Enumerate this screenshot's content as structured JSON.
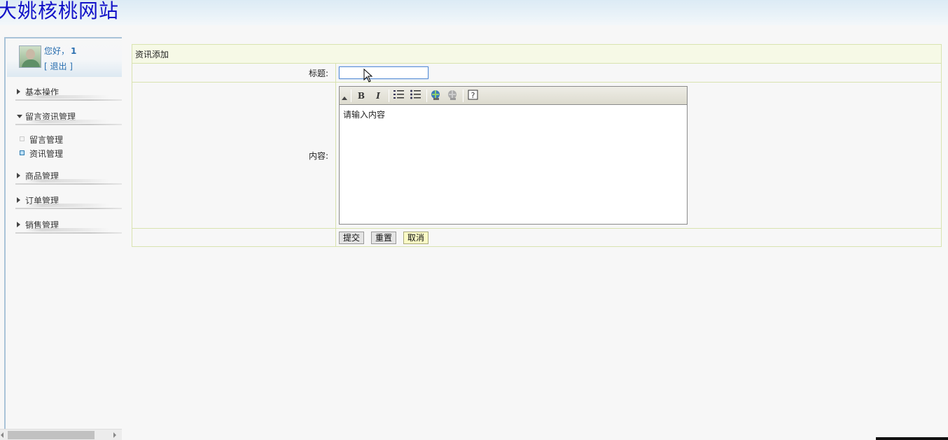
{
  "header": {
    "site_title": "大姚核桃网站"
  },
  "user": {
    "greeting": "您好，",
    "username": "1",
    "logout_label": "[ 退出 ]"
  },
  "sidebar": {
    "sections": [
      {
        "label": "基本操作",
        "expanded": false
      },
      {
        "label": "留言资讯管理",
        "expanded": true
      },
      {
        "label": "商品管理",
        "expanded": false
      },
      {
        "label": "订单管理",
        "expanded": false
      },
      {
        "label": "销售管理",
        "expanded": false
      }
    ],
    "sub_items": [
      {
        "label": "留言管理",
        "active": false
      },
      {
        "label": "资讯管理",
        "active": true
      }
    ]
  },
  "form": {
    "heading": "资讯添加",
    "title_label": "标题:",
    "title_value": "",
    "content_label": "内容:",
    "content_value": "请输入内容",
    "toolbar": [
      "bold-icon",
      "italic-icon",
      "ordered-list-icon",
      "unordered-list-icon",
      "link-icon",
      "unlink-icon",
      "help-icon"
    ],
    "buttons": {
      "submit": "提交",
      "reset": "重置",
      "cancel": "取消"
    }
  },
  "colors": {
    "title_blue": "#1212c8",
    "link_blue": "#2a6fb0",
    "form_border": "#d9e3b0",
    "form_header_bg": "#f6f9e6"
  }
}
